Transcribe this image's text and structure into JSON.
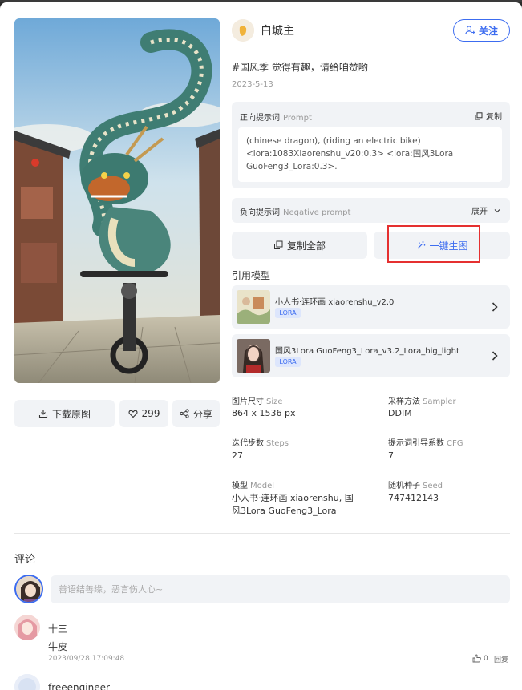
{
  "author": {
    "name": "白城主"
  },
  "follow_label": "关注",
  "post": {
    "description": "#国风季  觉得有趣，请给咱赞哟",
    "date": "2023-5-13"
  },
  "prompt": {
    "label": "正向提示词",
    "label_en": "Prompt",
    "copy_label": "复制",
    "text_line1": "(chinese dragon), (riding an electric bike)",
    "text_line2": "<lora:1083Xiaorenshu_v20:0.3> <lora:国风3Lora",
    "text_line3": "GuoFeng3_Lora:0.3>."
  },
  "negative": {
    "label": "负向提示词",
    "label_en": "Negative prompt",
    "expand_label": "展开"
  },
  "buttons": {
    "copy_all": "复制全部",
    "generate": "一键生图",
    "download": "下载原图",
    "likes": "299",
    "share": "分享"
  },
  "models": {
    "title": "引用模型",
    "items": [
      {
        "name": "小人书·连环画 xiaorenshu_v2.0",
        "tag": "LORA"
      },
      {
        "name": "国风3Lora GuoFeng3_Lora_v3.2_Lora_big_light",
        "tag": "LORA"
      }
    ]
  },
  "params": {
    "size_label": "图片尺寸",
    "size_label_en": "Size",
    "size_value": "864 x 1536 px",
    "sampler_label": "采样方法",
    "sampler_label_en": "Sampler",
    "sampler_value": "DDIM",
    "steps_label": "迭代步数",
    "steps_label_en": "Steps",
    "steps_value": "27",
    "cfg_label": "提示词引导系数",
    "cfg_label_en": "CFG",
    "cfg_value": "7",
    "model_label": "模型",
    "model_label_en": "Model",
    "model_value_line1": "小人书·连环画 xiaorenshu, 国",
    "model_value_line2": "风3Lora GuoFeng3_Lora",
    "seed_label": "随机种子",
    "seed_label_en": "Seed",
    "seed_value": "747412143"
  },
  "comments": {
    "title": "评论",
    "placeholder": "善语结善缘，恶言伤人心~",
    "items": [
      {
        "user": "十三",
        "text": "牛皮",
        "time": "2023/09/28 17:09:48",
        "likes": "0",
        "reply": "回复"
      },
      {
        "user": "freeengineer"
      }
    ]
  },
  "colors": {
    "accent": "#3c6cf0",
    "highlight_box": "#e53030",
    "panel_bg": "#f1f3f6"
  }
}
